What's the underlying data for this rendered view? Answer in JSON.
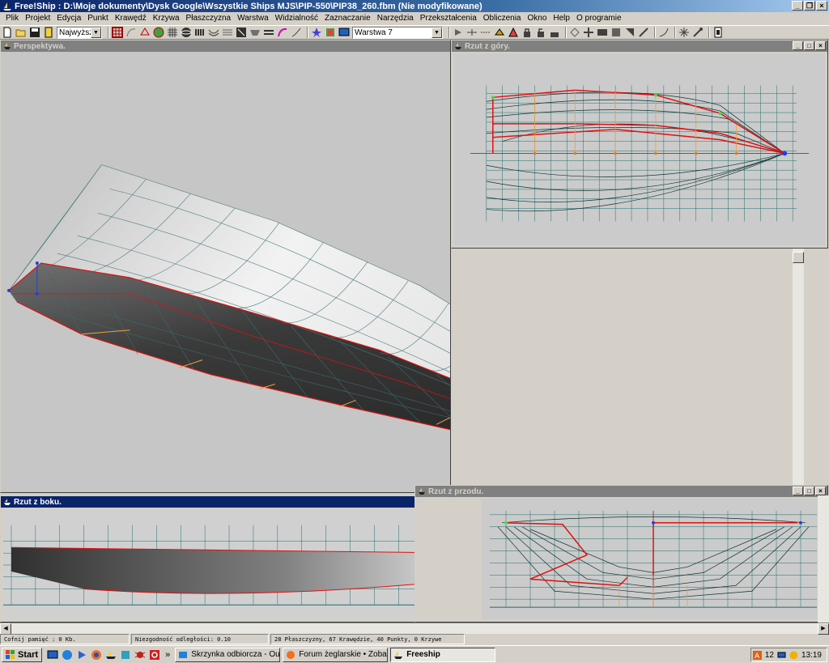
{
  "window": {
    "title": "Free!Ship : D:\\Moje dokumenty\\Dysk Google\\Wszystkie Ships MJS\\PIP-550\\PIP38_260.fbm (Nie modyfikowane)",
    "btn_min": "_",
    "btn_restore": "❐",
    "btn_close": "×"
  },
  "menu": [
    "Plik",
    "Projekt",
    "Edycja",
    "Punkt",
    "Krawędź",
    "Krzywa",
    "Płaszczyzna",
    "Warstwa",
    "Widzialność",
    "Zaznaczanie",
    "Narzędzia",
    "Przekształcenia",
    "Obliczenia",
    "Okno",
    "Help",
    "O programie"
  ],
  "toolbar": {
    "precision_value": "Najwyższy",
    "layer_value": "Warstwa 7"
  },
  "views": {
    "perspective": {
      "title": "Perspektywa."
    },
    "top": {
      "title": "Rzut z góry."
    },
    "side": {
      "title": "Rzut z boku."
    },
    "front": {
      "title": "Rzut z przodu."
    }
  },
  "status": {
    "undo_memory": "Cofnij pamięć : 0 Kb.",
    "tolerance": "Niezgodność odległości: 0.10",
    "counts": "28 Płaszczyzny, 67 Krawędzie, 40 Punkty, 0 Krzywe"
  },
  "taskbar": {
    "start": "Start",
    "more": "»",
    "tasks": [
      "Skrzynka odbiorcza - Out...",
      "Forum żeglarskie • Zobac...",
      "Freeship"
    ],
    "tray_text": "12",
    "clock": "13:19"
  },
  "colors": {
    "accent": "#0a246a",
    "hull_edge": "#e01010",
    "grid": "#1e6e6e",
    "orange_station": "#f0a040"
  }
}
